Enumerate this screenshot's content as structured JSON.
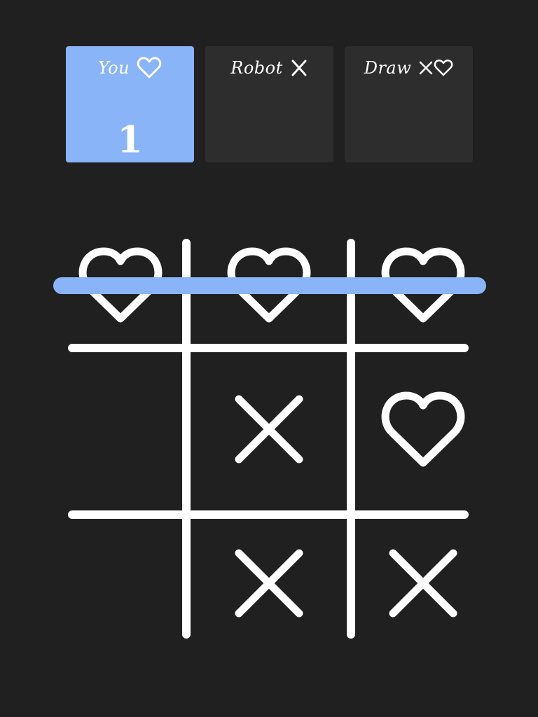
{
  "scoreboard": {
    "cards": [
      {
        "label": "You",
        "icon": "heart-icon",
        "score": "1",
        "active": true
      },
      {
        "label": "Robot",
        "icon": "x-icon",
        "score": "",
        "active": false
      },
      {
        "label": "Draw",
        "icon": "x-heart-icon",
        "score": "",
        "active": false
      }
    ]
  },
  "board": {
    "cells": [
      "O",
      "O",
      "O",
      "",
      "X",
      "O",
      "",
      "X",
      "X"
    ],
    "winning_line": "row-1"
  },
  "colors": {
    "background": "#202020",
    "card": "#2d2d2d",
    "accent": "#8ab4f8",
    "mark": "#ffffff"
  }
}
